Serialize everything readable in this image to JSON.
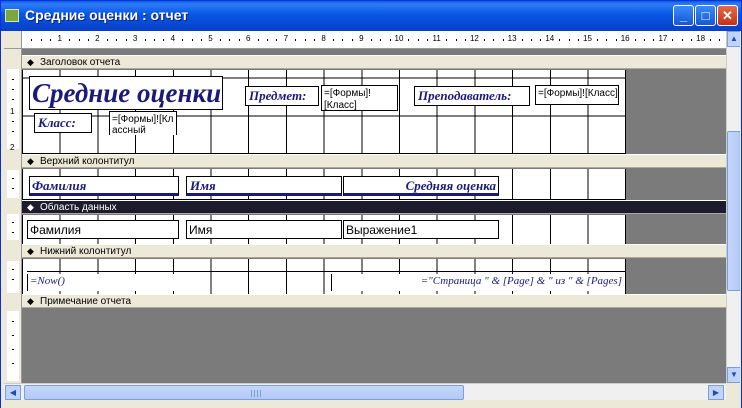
{
  "window": {
    "title": "Средние оценки : отчет",
    "buttons": {
      "minimize": "_",
      "maximize": "□",
      "close": "✕"
    }
  },
  "ruler": {
    "numbers": [
      "1",
      "2",
      "3",
      "4",
      "5",
      "6",
      "7",
      "8",
      "9",
      "10",
      "11",
      "12",
      "13",
      "14",
      "15",
      "16",
      "17",
      "18"
    ]
  },
  "vruler": {
    "header_nums": [
      "1",
      "2"
    ]
  },
  "sections": {
    "report_header": "Заголовок отчета",
    "page_header": "Верхний колонтитул",
    "detail": "Область данных",
    "page_footer": "Нижний колонтитул",
    "report_footer": "Примечание отчета"
  },
  "report_header": {
    "title": "Средние оценки",
    "subject_label": "Предмет:",
    "subject_value": "=[Формы]![Класс]",
    "teacher_label": "Преподаватель:",
    "teacher_value": "=[Формы]![Класс]",
    "class_label": "Класс:",
    "class_value": "=[Формы]![Кл ассный"
  },
  "page_header": {
    "col_surname": "Фамилия",
    "col_name": "Имя",
    "col_avg": "Средняя оценка"
  },
  "detail": {
    "surname": "Фамилия",
    "name": "Имя",
    "expr": "Выражение1"
  },
  "page_footer": {
    "now": "=Now()",
    "pages": "=\"Страница \" & [Page] & \" из \" & [Pages]"
  },
  "scroll": {
    "up": "▲",
    "down": "▼",
    "left": "◀",
    "right": "▶"
  }
}
